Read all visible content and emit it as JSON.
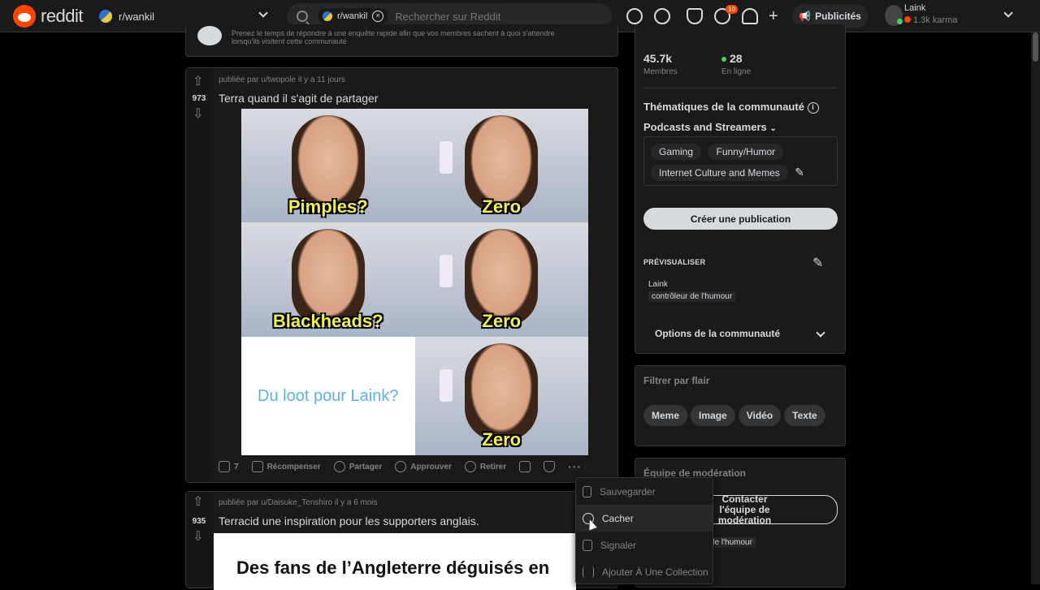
{
  "header": {
    "logo_text": "reddit",
    "community": "r/wankil",
    "search_chip": "r/wankil",
    "search_placeholder": "Rechercher sur Reddit",
    "notification_count": "10",
    "ads_label": "Publicités",
    "user_name": "Laink",
    "user_karma": "1.3k karma"
  },
  "banner": {
    "text": "Prenez le temps de répondre à une enquête rapide afin que vos membres sachent à quoi s'attendre lorsqu'ils visitent cette communauté"
  },
  "posts": [
    {
      "votes": "973",
      "meta": "publiée par  u/twopole il y a 11 jours",
      "title": "Terra quand il s'agit de partager",
      "captions": [
        "Pimples?",
        "Zero",
        "Blackheads?",
        "Zero",
        "Du loot pour Laink?",
        "Zero"
      ],
      "actions": {
        "comments": "7",
        "award": "Récompenser",
        "share": "Partager",
        "approve": "Approuver",
        "remove": "Retirer"
      }
    },
    {
      "votes": "935",
      "meta": "publiée par  u/Daisuke_Tenshiro il y a 6 mois",
      "title": "Terracid une inspiration pour les supporters anglais.",
      "image_headline": "Des fans de l’Angleterre déguisés en"
    }
  ],
  "context_menu": {
    "items": [
      "Sauvegarder",
      "Cacher",
      "Signaler",
      "Ajouter À Une Collection"
    ]
  },
  "sidebar": {
    "members_value": "45.7k",
    "members_label": "Membres",
    "online_value": "28",
    "online_label": "En ligne",
    "topics_title": "Thématiques de la communauté",
    "topics_category": "Podcasts and Streamers",
    "tags": [
      "Gaming",
      "Funny/Humor",
      "Internet Culture and Memes"
    ],
    "create_post": "Créer une publication",
    "preview_title": "PRÉVISUALISER",
    "preview_user": "Laink",
    "preview_flair": "contrôleur de l'humour",
    "options": "Options de la communauté",
    "flair_title": "Filtrer par flair",
    "flairs": [
      "Meme",
      "Image",
      "Vidéo",
      "Texte"
    ],
    "mod_title": "Équipe de modération",
    "mod_contact": "Contacter l'équipe de modération",
    "mod_flair": "de l'humour"
  },
  "colors": {
    "accent": "#ff4500",
    "online": "#46d160",
    "caption": "#f2ee55"
  }
}
